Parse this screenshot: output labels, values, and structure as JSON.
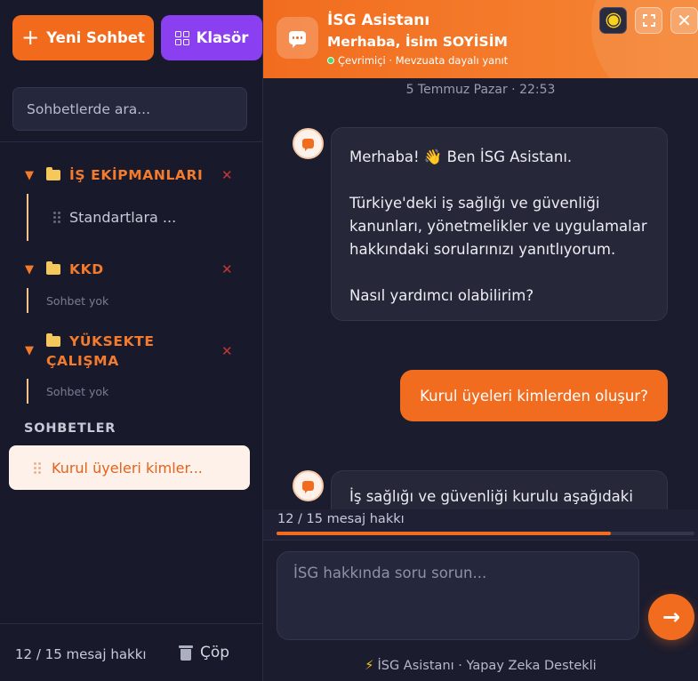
{
  "sidebar": {
    "new_chat_label": "Yeni Sohbet",
    "folder_button_label": "Klasör",
    "search_placeholder": "Sohbetlerde ara...",
    "folders": [
      {
        "name": "İŞ EKİPMANLARI",
        "chats": [
          "Standartlara ..."
        ],
        "empty_label": ""
      },
      {
        "name": "KKD",
        "chats": [],
        "empty_label": "Sohbet yok"
      },
      {
        "name_line1": "YÜKSEKTE",
        "name_line2": "ÇALIŞMA",
        "chats": [],
        "empty_label": "Sohbet yok"
      }
    ],
    "section_title": "SOHBETLER",
    "chats": [
      "Kurul üyeleri kimler..."
    ],
    "quota_text": "12 / 15 mesaj hakkı",
    "trash_label": "Çöp"
  },
  "header": {
    "title": "İSG Asistanı",
    "greeting": "Merhaba, İsim SOYİSİM",
    "status": "Çevrimiçi · Mevzuata dayalı yanıt",
    "close_symbol": "✕"
  },
  "messages": {
    "date": "5 Temmuz Pazar · 22:53",
    "bot_1": "Merhaba! 👋 Ben İSG Asistanı.\n\nTürkiye'deki iş sağlığı ve güvenliği kanunları, yönetmelikler ve uygulamalar hakkındaki sorularınızı yanıtlıyorum.\n\nNasıl yardımcı olabilirim?",
    "user_1": "Kurul üyeleri kimlerden oluşur?",
    "bot_2": "İş sağlığı ve güvenliği kurulu aşağıdaki"
  },
  "composer": {
    "quota_text": "12 / 15 mesaj hakkı",
    "quota_used": 12,
    "quota_total": 15,
    "placeholder": "İSG hakkında soru sorun...",
    "send_symbol": "→",
    "footer": "İSG Asistanı · Yapay Zeka Destekli"
  },
  "colors": {
    "accent": "#f26c1f",
    "folder_button": "#8a3ff0",
    "background": "#1a1b2e",
    "status_online": "#4ad96b",
    "delete": "#c6362f"
  },
  "icons": {
    "new_chat": "plus-icon",
    "folder_button": "grid-icon",
    "folder": "folder-icon",
    "theme": "sun-icon",
    "expand": "expand-icon",
    "close": "close-icon",
    "send": "arrow-right-icon",
    "trash": "trash-icon",
    "footer": "lightning-icon"
  }
}
